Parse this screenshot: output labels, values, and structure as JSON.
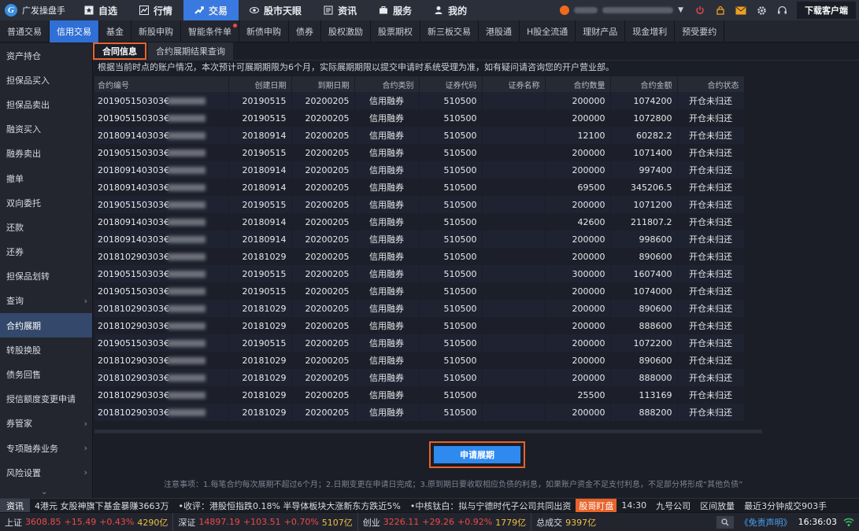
{
  "app": {
    "name": "广发操盘手"
  },
  "topnav": [
    {
      "label": "自选",
      "icon": "star-icon"
    },
    {
      "label": "行情",
      "icon": "chart-icon"
    },
    {
      "label": "交易",
      "icon": "trade-icon",
      "active": true
    },
    {
      "label": "股市天眼",
      "icon": "eye-icon"
    },
    {
      "label": "资讯",
      "icon": "news-icon"
    },
    {
      "label": "服务",
      "icon": "briefcase-icon"
    },
    {
      "label": "我的",
      "icon": "user-icon"
    }
  ],
  "topright": {
    "download": "下载客户端"
  },
  "subnav": [
    "普通交易",
    "信用交易",
    "基金",
    "新股申购",
    "智能条件单",
    "新债申购",
    "债券",
    "股权激励",
    "股票期权",
    "新三板交易",
    "港股通",
    "H股全流通",
    "理财产品",
    "现金增利",
    "预受要约"
  ],
  "subnav_active": "信用交易",
  "sidebar": [
    {
      "label": "资产持仓"
    },
    {
      "label": "担保品买入"
    },
    {
      "label": "担保品卖出"
    },
    {
      "label": "融资买入"
    },
    {
      "label": "融券卖出"
    },
    {
      "label": "撤单"
    },
    {
      "label": "双向委托"
    },
    {
      "label": "还款"
    },
    {
      "label": "还券"
    },
    {
      "label": "担保品划转"
    },
    {
      "label": "查询",
      "chevron": true
    },
    {
      "label": "合约展期",
      "active": true
    },
    {
      "label": "转股换股"
    },
    {
      "label": "债务回售"
    },
    {
      "label": "授信额度变更申请"
    },
    {
      "label": "券管家",
      "chevron": true
    },
    {
      "label": "专项融券业务",
      "chevron": true
    },
    {
      "label": "风险设置",
      "chevron": true
    }
  ],
  "tabs": [
    {
      "label": "合同信息",
      "active": true
    },
    {
      "label": "合约展期结果查询"
    }
  ],
  "notice": "根据当前时点的账户情况，本次预计可展期期限为6个月，实际展期期限以提交申请时系统受理为准，如有疑问请咨询您的开户营业部。",
  "table": {
    "headers": [
      "合约编号",
      "创建日期",
      "到期日期",
      "合约类别",
      "证券代码",
      "证券名称",
      "合约数量",
      "合约金额",
      "合约状态"
    ],
    "rows": [
      [
        "201905150303€",
        "20190515",
        "20200205",
        "信用融券",
        "510500",
        "",
        "200000",
        "1074200",
        "开仓未归还"
      ],
      [
        "201905150303€",
        "20190515",
        "20200205",
        "信用融券",
        "510500",
        "",
        "200000",
        "1072800",
        "开仓未归还"
      ],
      [
        "201809140303€",
        "20180914",
        "20200205",
        "信用融券",
        "510500",
        "",
        "12100",
        "60282.2",
        "开仓未归还"
      ],
      [
        "201905150303€",
        "20190515",
        "20200205",
        "信用融券",
        "510500",
        "",
        "200000",
        "1071400",
        "开仓未归还"
      ],
      [
        "201809140303€",
        "20180914",
        "20200205",
        "信用融券",
        "510500",
        "",
        "200000",
        "997400",
        "开仓未归还"
      ],
      [
        "201809140303€",
        "20180914",
        "20200205",
        "信用融券",
        "510500",
        "",
        "69500",
        "345206.5",
        "开仓未归还"
      ],
      [
        "201905150303€",
        "20190515",
        "20200205",
        "信用融券",
        "510500",
        "",
        "200000",
        "1071200",
        "开仓未归还"
      ],
      [
        "201809140303€",
        "20180914",
        "20200205",
        "信用融券",
        "510500",
        "",
        "42600",
        "211807.2",
        "开仓未归还"
      ],
      [
        "201809140303€",
        "20180914",
        "20200205",
        "信用融券",
        "510500",
        "",
        "200000",
        "998600",
        "开仓未归还"
      ],
      [
        "201810290303€",
        "20181029",
        "20200205",
        "信用融券",
        "510500",
        "",
        "200000",
        "890600",
        "开仓未归还"
      ],
      [
        "201905150303€",
        "20190515",
        "20200205",
        "信用融券",
        "510500",
        "",
        "300000",
        "1607400",
        "开仓未归还"
      ],
      [
        "201905150303€",
        "20190515",
        "20200205",
        "信用融券",
        "510500",
        "",
        "200000",
        "1074000",
        "开仓未归还"
      ],
      [
        "201810290303€",
        "20181029",
        "20200205",
        "信用融券",
        "510500",
        "",
        "200000",
        "890600",
        "开仓未归还"
      ],
      [
        "201810290303€",
        "20181029",
        "20200205",
        "信用融券",
        "510500",
        "",
        "200000",
        "888600",
        "开仓未归还"
      ],
      [
        "201905150303€",
        "20190515",
        "20200205",
        "信用融券",
        "510500",
        "",
        "200000",
        "1072200",
        "开仓未归还"
      ],
      [
        "201810290303€",
        "20181029",
        "20200205",
        "信用融券",
        "510500",
        "",
        "200000",
        "890600",
        "开仓未归还"
      ],
      [
        "201810290303€",
        "20181029",
        "20200205",
        "信用融券",
        "510500",
        "",
        "200000",
        "888000",
        "开仓未归还"
      ],
      [
        "201810290303€",
        "20181029",
        "20200205",
        "信用融券",
        "510500",
        "",
        "25500",
        "113169",
        "开仓未归还"
      ],
      [
        "201810290303€",
        "20181029",
        "20200205",
        "信用融券",
        "510500",
        "",
        "200000",
        "888200",
        "开仓未归还"
      ]
    ]
  },
  "apply_button": "申请展期",
  "footnote": "注意事项：1.每笔合约每次展期不超过6个月；2.日期变更在申请日完成；3.原到期日要收取相应负债的利息，如果账户资金不足支付利息，不足部分将形成“其他负债”",
  "ticker": {
    "label": "资讯",
    "items": [
      "4港元 女股神旗下基金暴赚3663万",
      "•收评：港股恒指跌0.18% 半导体板块大涨新东方跌近5%",
      "•中核钛白：拟与宁德时代子公司共同出资"
    ],
    "hot": "股哥盯盘",
    "time": "14:30",
    "company": "九号公司",
    "event": "区间放量",
    "extra": "最近3分钟成交903手"
  },
  "status": {
    "indices": [
      {
        "name": "上证",
        "value": "3608.85",
        "change": "+15.49",
        "pct": "+0.43%",
        "volume": "4290亿"
      },
      {
        "name": "深证",
        "value": "14897.19",
        "change": "+103.51",
        "pct": "+0.70%",
        "volume": "5107亿"
      },
      {
        "name": "创业",
        "value": "3226.11",
        "change": "+29.26",
        "pct": "+0.92%",
        "volume": "1779亿"
      }
    ],
    "total_label": "总成交",
    "total_value": "9397亿",
    "disclaimer": "《免责声明》",
    "time": "16:36:03"
  },
  "colors": {
    "accent": "#2f8af0",
    "highlight": "#e8632a",
    "up": "#f04848",
    "volume": "#f0c040"
  }
}
